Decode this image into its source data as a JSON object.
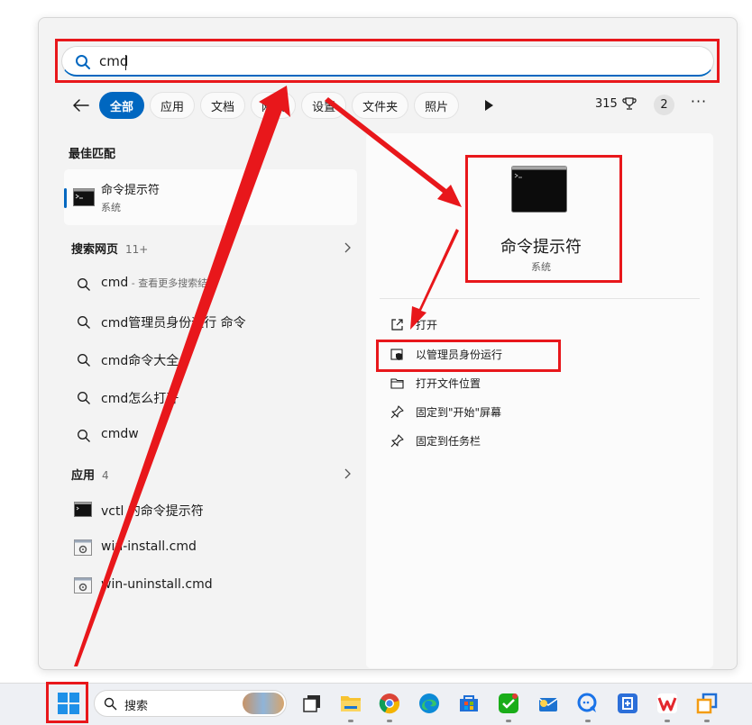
{
  "search": {
    "query": "cmd"
  },
  "filters": {
    "chips": [
      "全部",
      "应用",
      "文档",
      "网页",
      "设置",
      "文件夹",
      "照片"
    ],
    "points": "315",
    "badge": "2"
  },
  "left": {
    "best_match_title": "最佳匹配",
    "best_match": {
      "name": "命令提示符",
      "sub": "系统"
    },
    "web_title": "搜索网页",
    "web_count": "11+",
    "web_items": [
      {
        "text": "cmd",
        "sub": " - 查看更多搜索结果"
      },
      {
        "text": "cmd管理员身份运行 命令"
      },
      {
        "text": "cmd命令大全"
      },
      {
        "text": "cmd怎么打开"
      },
      {
        "text": "cmdw"
      }
    ],
    "apps_title": "应用",
    "apps_count": "4",
    "apps": [
      {
        "text": "vctl 的命令提示符",
        "icon": "console-icon"
      },
      {
        "text": "win-install.cmd",
        "icon": "cmd-file-icon"
      },
      {
        "text": "win-uninstall.cmd",
        "icon": "cmd-file-icon"
      }
    ]
  },
  "detail": {
    "title": "命令提示符",
    "sub": "系统",
    "actions": [
      {
        "label": "打开",
        "icon": "open-external-icon"
      },
      {
        "label": "以管理员身份运行",
        "icon": "shield-icon"
      },
      {
        "label": "打开文件位置",
        "icon": "folder-icon"
      },
      {
        "label": "固定到\"开始\"屏幕",
        "icon": "pin-icon"
      },
      {
        "label": "固定到任务栏",
        "icon": "pin-icon"
      }
    ]
  },
  "taskbar": {
    "search_label": "搜索",
    "apps": [
      "task-view-icon",
      "file-explorer-icon",
      "chrome-icon",
      "edge-icon",
      "store-icon",
      "wechat-icon",
      "mail-icon",
      "chat-icon",
      "tool-icon",
      "wps-icon",
      "vm-icon"
    ]
  },
  "colors": {
    "accent": "#0067c0",
    "annotation": "#e8171b"
  }
}
